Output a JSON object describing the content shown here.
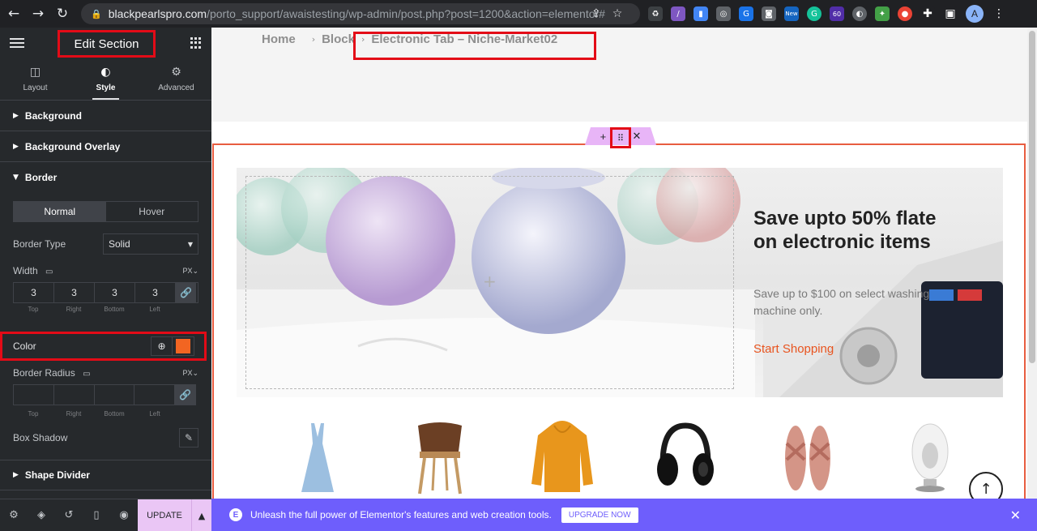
{
  "browser": {
    "url_host": "blackpearlspro.com",
    "url_path": "/porto_support/awaistesting/wp-admin/post.php?post=1200&action=elementor#",
    "ext_badge_new": "New",
    "ext_badge_count": "60",
    "avatar_letter": "A"
  },
  "panel": {
    "title": "Edit Section",
    "tabs": [
      {
        "label": "Layout",
        "icon": "layout-icon"
      },
      {
        "label": "Style",
        "icon": "half-circle-icon"
      },
      {
        "label": "Advanced",
        "icon": "gear-icon"
      }
    ],
    "sections": {
      "background": "Background",
      "background_overlay": "Background Overlay",
      "border": "Border",
      "shape_divider": "Shape Divider"
    },
    "state_tabs": {
      "normal": "Normal",
      "hover": "Hover"
    },
    "border_type": {
      "label": "Border Type",
      "value": "Solid"
    },
    "width": {
      "label": "Width",
      "unit": "PX",
      "values": [
        "3",
        "3",
        "3",
        "3"
      ],
      "labels": [
        "Top",
        "Right",
        "Bottom",
        "Left"
      ]
    },
    "color": {
      "label": "Color",
      "value": "#f26522"
    },
    "border_radius": {
      "label": "Border Radius",
      "unit": "PX",
      "values": [
        "",
        "",
        "",
        ""
      ],
      "labels": [
        "Top",
        "Right",
        "Bottom",
        "Left"
      ]
    },
    "box_shadow": {
      "label": "Box Shadow"
    },
    "footer": {
      "update_label": "UPDATE"
    }
  },
  "canvas": {
    "breadcrumb": [
      "Home",
      "Block",
      "Electronic Tab – Niche-Market02"
    ],
    "banner": {
      "heading": "Save upto 50% flate on electronic items",
      "subtext": "Save up to $100 on select washing machine only.",
      "cta": "Start Shopping"
    },
    "products": [
      {
        "name": "dress"
      },
      {
        "name": "chair"
      },
      {
        "name": "hoodie"
      },
      {
        "name": "headphones"
      },
      {
        "name": "sandals"
      },
      {
        "name": "speaker"
      }
    ]
  },
  "promo": {
    "text": "Unleash the full power of Elementor's features and web creation tools.",
    "button": "UPGRADE NOW"
  },
  "colors": {
    "accent_red": "#e30b17",
    "border_orange": "#f26522",
    "promo_purple": "#6e5efc",
    "update_pink": "#eac6f5"
  }
}
